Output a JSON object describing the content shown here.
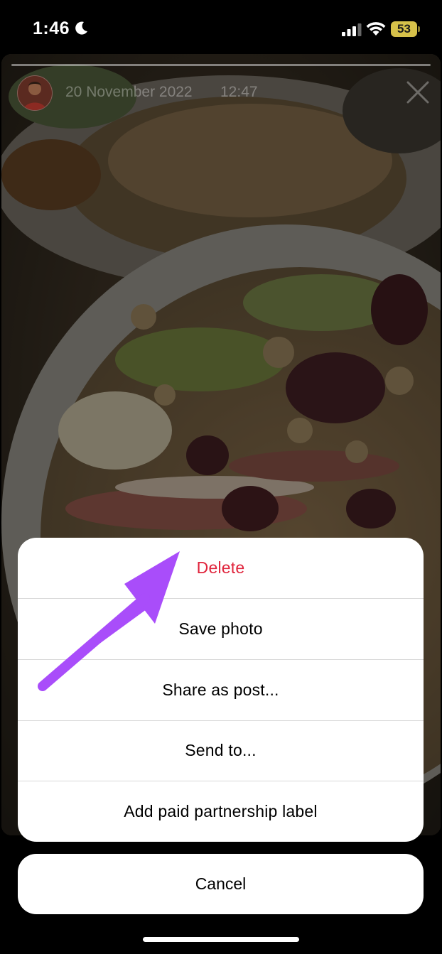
{
  "status_bar": {
    "time": "1:46",
    "battery": "53",
    "icons": [
      "moon-icon",
      "signal-icon",
      "wifi-icon",
      "battery-icon"
    ]
  },
  "story": {
    "date": "20 November 2022",
    "time": "12:47"
  },
  "action_sheet": {
    "items": [
      {
        "label": "Delete",
        "style": "destructive"
      },
      {
        "label": "Save photo",
        "style": "default"
      },
      {
        "label": "Share as post...",
        "style": "default"
      },
      {
        "label": "Send to...",
        "style": "default"
      },
      {
        "label": "Add paid partnership label",
        "style": "default"
      }
    ],
    "cancel_label": "Cancel"
  },
  "colors": {
    "destructive": "#e0243c",
    "annotation_arrow": "#a94dfa",
    "battery": "#d6c14a"
  }
}
